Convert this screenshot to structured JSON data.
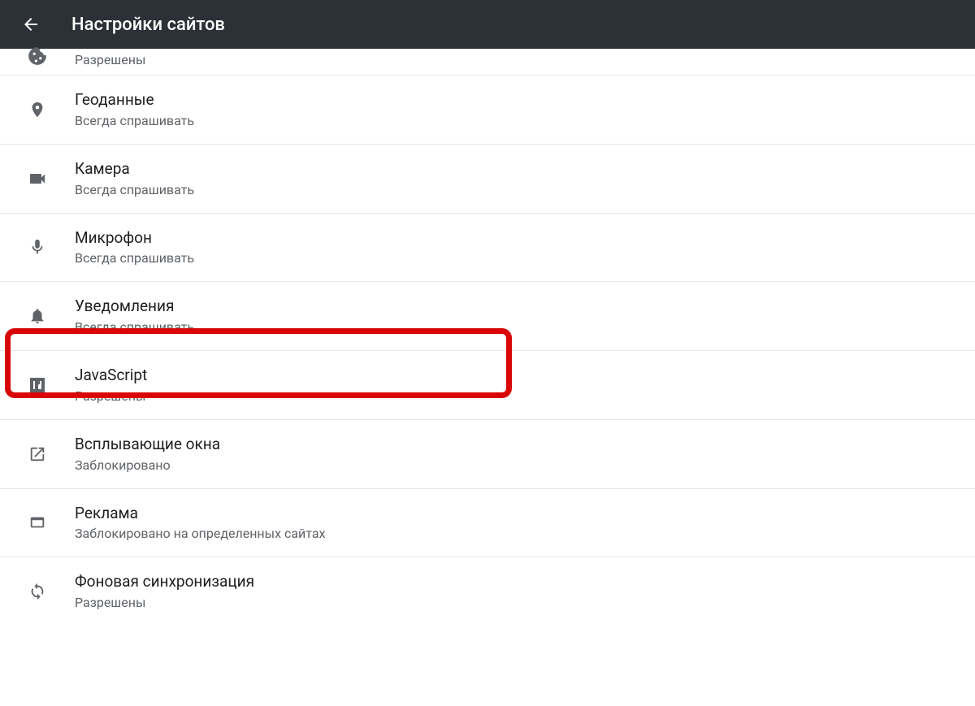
{
  "header": {
    "title": "Настройки сайтов"
  },
  "items": [
    {
      "title": "",
      "subtitle": "Разрешены",
      "icon": "cookie"
    },
    {
      "title": "Геоданные",
      "subtitle": "Всегда спрашивать",
      "icon": "location"
    },
    {
      "title": "Камера",
      "subtitle": "Всегда спрашивать",
      "icon": "camera"
    },
    {
      "title": "Микрофон",
      "subtitle": "Всегда спрашивать",
      "icon": "microphone"
    },
    {
      "title": "Уведомления",
      "subtitle": "Всегда спрашивать",
      "icon": "bell"
    },
    {
      "title": "JavaScript",
      "subtitle": "Разрешены",
      "icon": "js"
    },
    {
      "title": "Всплывающие окна",
      "subtitle": "Заблокировано",
      "icon": "popup"
    },
    {
      "title": "Реклама",
      "subtitle": "Заблокировано на определенных сайтах",
      "icon": "ad"
    },
    {
      "title": "Фоновая синхронизация",
      "subtitle": "Разрешены",
      "icon": "sync"
    }
  ]
}
